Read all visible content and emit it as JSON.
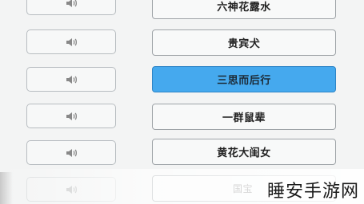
{
  "rows": [
    {
      "word": "六神花露水",
      "selected": false
    },
    {
      "word": "贵宾犬",
      "selected": false
    },
    {
      "word": "三思而后行",
      "selected": true
    },
    {
      "word": "一群鼠辈",
      "selected": false
    },
    {
      "word": "黄花大闺女",
      "selected": false
    },
    {
      "word": "国宝",
      "selected": false
    }
  ],
  "audio_icon": "speaker-icon",
  "colors": {
    "selected_fill": "#45a9ee",
    "background": "#f3f4f4"
  },
  "watermark": "睡安手游网"
}
